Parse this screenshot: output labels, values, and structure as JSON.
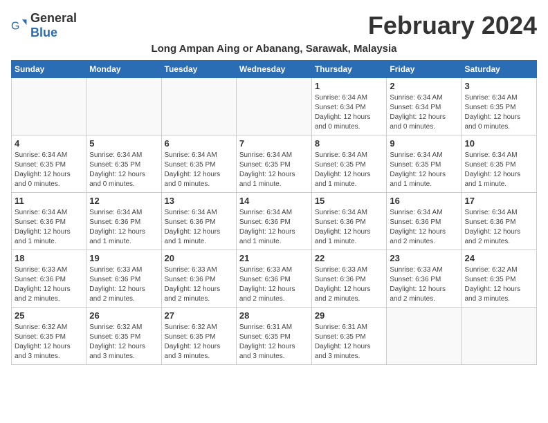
{
  "logo": {
    "general": "General",
    "blue": "Blue"
  },
  "title": "February 2024",
  "subtitle": "Long Ampan Aing or Abanang, Sarawak, Malaysia",
  "days_of_week": [
    "Sunday",
    "Monday",
    "Tuesday",
    "Wednesday",
    "Thursday",
    "Friday",
    "Saturday"
  ],
  "weeks": [
    [
      {
        "day": "",
        "info": ""
      },
      {
        "day": "",
        "info": ""
      },
      {
        "day": "",
        "info": ""
      },
      {
        "day": "",
        "info": ""
      },
      {
        "day": "1",
        "info": "Sunrise: 6:34 AM\nSunset: 6:34 PM\nDaylight: 12 hours and 0 minutes."
      },
      {
        "day": "2",
        "info": "Sunrise: 6:34 AM\nSunset: 6:34 PM\nDaylight: 12 hours and 0 minutes."
      },
      {
        "day": "3",
        "info": "Sunrise: 6:34 AM\nSunset: 6:35 PM\nDaylight: 12 hours and 0 minutes."
      }
    ],
    [
      {
        "day": "4",
        "info": "Sunrise: 6:34 AM\nSunset: 6:35 PM\nDaylight: 12 hours and 0 minutes."
      },
      {
        "day": "5",
        "info": "Sunrise: 6:34 AM\nSunset: 6:35 PM\nDaylight: 12 hours and 0 minutes."
      },
      {
        "day": "6",
        "info": "Sunrise: 6:34 AM\nSunset: 6:35 PM\nDaylight: 12 hours and 0 minutes."
      },
      {
        "day": "7",
        "info": "Sunrise: 6:34 AM\nSunset: 6:35 PM\nDaylight: 12 hours and 1 minute."
      },
      {
        "day": "8",
        "info": "Sunrise: 6:34 AM\nSunset: 6:35 PM\nDaylight: 12 hours and 1 minute."
      },
      {
        "day": "9",
        "info": "Sunrise: 6:34 AM\nSunset: 6:35 PM\nDaylight: 12 hours and 1 minute."
      },
      {
        "day": "10",
        "info": "Sunrise: 6:34 AM\nSunset: 6:35 PM\nDaylight: 12 hours and 1 minute."
      }
    ],
    [
      {
        "day": "11",
        "info": "Sunrise: 6:34 AM\nSunset: 6:36 PM\nDaylight: 12 hours and 1 minute."
      },
      {
        "day": "12",
        "info": "Sunrise: 6:34 AM\nSunset: 6:36 PM\nDaylight: 12 hours and 1 minute."
      },
      {
        "day": "13",
        "info": "Sunrise: 6:34 AM\nSunset: 6:36 PM\nDaylight: 12 hours and 1 minute."
      },
      {
        "day": "14",
        "info": "Sunrise: 6:34 AM\nSunset: 6:36 PM\nDaylight: 12 hours and 1 minute."
      },
      {
        "day": "15",
        "info": "Sunrise: 6:34 AM\nSunset: 6:36 PM\nDaylight: 12 hours and 1 minute."
      },
      {
        "day": "16",
        "info": "Sunrise: 6:34 AM\nSunset: 6:36 PM\nDaylight: 12 hours and 2 minutes."
      },
      {
        "day": "17",
        "info": "Sunrise: 6:34 AM\nSunset: 6:36 PM\nDaylight: 12 hours and 2 minutes."
      }
    ],
    [
      {
        "day": "18",
        "info": "Sunrise: 6:33 AM\nSunset: 6:36 PM\nDaylight: 12 hours and 2 minutes."
      },
      {
        "day": "19",
        "info": "Sunrise: 6:33 AM\nSunset: 6:36 PM\nDaylight: 12 hours and 2 minutes."
      },
      {
        "day": "20",
        "info": "Sunrise: 6:33 AM\nSunset: 6:36 PM\nDaylight: 12 hours and 2 minutes."
      },
      {
        "day": "21",
        "info": "Sunrise: 6:33 AM\nSunset: 6:36 PM\nDaylight: 12 hours and 2 minutes."
      },
      {
        "day": "22",
        "info": "Sunrise: 6:33 AM\nSunset: 6:36 PM\nDaylight: 12 hours and 2 minutes."
      },
      {
        "day": "23",
        "info": "Sunrise: 6:33 AM\nSunset: 6:36 PM\nDaylight: 12 hours and 2 minutes."
      },
      {
        "day": "24",
        "info": "Sunrise: 6:32 AM\nSunset: 6:35 PM\nDaylight: 12 hours and 3 minutes."
      }
    ],
    [
      {
        "day": "25",
        "info": "Sunrise: 6:32 AM\nSunset: 6:35 PM\nDaylight: 12 hours and 3 minutes."
      },
      {
        "day": "26",
        "info": "Sunrise: 6:32 AM\nSunset: 6:35 PM\nDaylight: 12 hours and 3 minutes."
      },
      {
        "day": "27",
        "info": "Sunrise: 6:32 AM\nSunset: 6:35 PM\nDaylight: 12 hours and 3 minutes."
      },
      {
        "day": "28",
        "info": "Sunrise: 6:31 AM\nSunset: 6:35 PM\nDaylight: 12 hours and 3 minutes."
      },
      {
        "day": "29",
        "info": "Sunrise: 6:31 AM\nSunset: 6:35 PM\nDaylight: 12 hours and 3 minutes."
      },
      {
        "day": "",
        "info": ""
      },
      {
        "day": "",
        "info": ""
      }
    ]
  ]
}
